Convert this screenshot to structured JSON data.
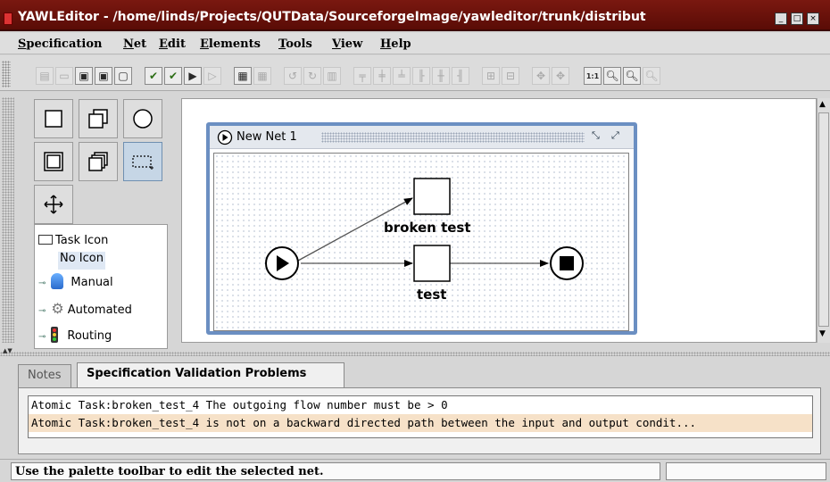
{
  "window": {
    "title": "YAWLEditor - /home/linds/Projects/QUTData/SourceforgeImage/yawleditor/trunk/distribut"
  },
  "menu": [
    "Specification",
    "Net",
    "Edit",
    "Elements",
    "Tools",
    "View",
    "Help"
  ],
  "toolbar": {
    "buttons": [
      "new-spec-icon",
      "open-spec-icon",
      "save-icon",
      "save-as-icon",
      "close-spec-icon",
      "validate-icon",
      "analyse-icon",
      "export-icon",
      "import-icon",
      "new-net-icon",
      "remove-net-icon",
      "undo-icon",
      "redo-icon",
      "delete-icon",
      "align-top-icon",
      "align-middle-icon",
      "align-bottom-icon",
      "align-left-icon",
      "align-center-icon",
      "align-right-icon",
      "increase-size-icon",
      "decrease-size-icon",
      "zoom-selected-icon",
      "zoom-fit-icon",
      "zoom-actual-icon",
      "zoom-out-icon",
      "zoom-in-icon",
      "zoom-reset-icon"
    ],
    "zoom_actual_label": "1:1"
  },
  "palette": {
    "tools": [
      "atomic-task-tool",
      "composite-task-tool",
      "condition-tool",
      "multiple-atomic-task-tool",
      "multiple-composite-task-tool",
      "marquee-select-tool",
      "drag-net-tool"
    ]
  },
  "tree": {
    "root": "Task Icon",
    "items": [
      {
        "label": "No Icon",
        "icon": "none",
        "selected": true
      },
      {
        "label": "Manual",
        "icon": "person-icon"
      },
      {
        "label": "Automated",
        "icon": "gears-icon"
      },
      {
        "label": "Routing",
        "icon": "traffic-light-icon"
      }
    ]
  },
  "net": {
    "title": "New Net 1",
    "tasks": [
      {
        "label": "broken test"
      },
      {
        "label": "test"
      }
    ]
  },
  "tabs": [
    {
      "label": "Notes",
      "active": false
    },
    {
      "label": "Specification Validation Problems",
      "active": true
    }
  ],
  "problems": [
    "Atomic Task:broken_test_4 The outgoing flow number must be > 0",
    "Atomic Task:broken_test_4 is not on a backward directed path between the input and output condit..."
  ],
  "status": {
    "message": "Use the palette toolbar to edit the selected net."
  },
  "colors": {
    "titlebar": "#6a1209",
    "net_frame": "#6b8fc2",
    "selected_row": "#f6e1c8"
  }
}
